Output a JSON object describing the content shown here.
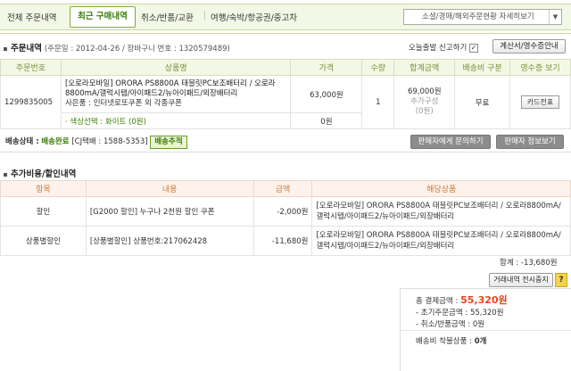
{
  "nav": {
    "items": [
      "전체 주문내역",
      "최근 구매내역",
      "취소/반품/교환",
      "여행/숙박/항공권/중고차"
    ],
    "separator": "|",
    "select_value": "소셜/경매/해외주문현황 자세히보기",
    "select_arrow": "▼"
  },
  "order": {
    "section_title": "주문내역",
    "meta": "(주문일 : 2012-04-26 / 장바구니 번호 : 1320579489)",
    "hide_check_label": "오늘출발 신고하기",
    "check_mark": "✓",
    "receipt_button": "계산서/영수증안내",
    "columns": [
      "주문번호",
      "상품명",
      "가격",
      "수량",
      "합계금액",
      "배송비 구분",
      "영수증 보기"
    ],
    "order_no": "1299835005",
    "product_name": "[오로라모바일] ORORA PS8800A 태블릿PC보조배터리 / 오로라8800mA/갤럭시탭/아이패드2/뉴아이패드/외장배터리",
    "gift": "사은품 : 인터넷로또쿠폰 외 각종쿠폰",
    "price": "63,000원",
    "qty": "1",
    "total": "69,000원",
    "total_sub1": "추가구성",
    "total_sub2": "(0원)",
    "shipping_type": "무료",
    "card_button": "카드전표",
    "option": "· 색상선택 : 화이트 (0원)",
    "option_price": "0원",
    "status_label": "배송상태 :",
    "status_value": "배송완료",
    "carrier": "[CJ택배 : 1588-5353]",
    "track_button": "배송추적",
    "ask_seller_button": "판매자에게 문의하기",
    "seller_info_button": "판매자 정보보기"
  },
  "extra": {
    "section_title": "추가비용/할인내역",
    "columns": [
      "항목",
      "내용",
      "금액",
      "해당상품"
    ],
    "rows": [
      {
        "item": "할인",
        "desc": "[G2000 할인] 누구나 2천원 할인 쿠폰",
        "amount": "-2,000원",
        "product": "[오로라모바일] ORORA PS8800A 태블릿PC보조배터리 / 오로라8800mA/갤럭시탭/아이패드2/뉴아이패드/외장배터리"
      },
      {
        "item": "상품별할인",
        "desc": "[상품별할인] 상품번호:217062428",
        "amount": "-11,680원",
        "product": "[오로라모바일] ORORA PS8800A 태블릿PC보조배터리 / 오로라8800mA/갤럭시탭/아이패드2/뉴아이패드/외장배터리"
      }
    ],
    "sum_label": "합계 :",
    "sum_value": "-13,680원",
    "history_button": "거래내역 전시중지",
    "help_icon": "?"
  },
  "summary": {
    "total_label": "총 결제금액 :",
    "total_value": "55,320원",
    "initial_label": "- 초기주문금액 :",
    "initial_value": "55,320원",
    "cancel_label": "- 취소/반품금액 :",
    "cancel_value": "0원",
    "ship_label": "배송비 착불상품 :",
    "ship_value": "0개"
  }
}
